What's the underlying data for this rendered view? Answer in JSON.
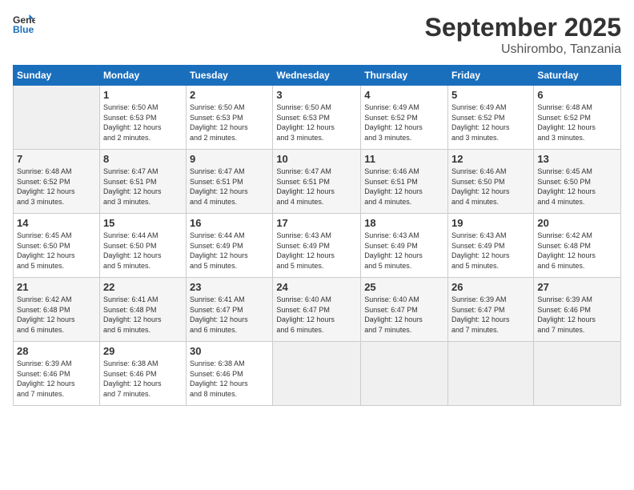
{
  "logo": {
    "line1": "General",
    "line2": "Blue"
  },
  "title": "September 2025",
  "subtitle": "Ushirombo, Tanzania",
  "days_header": [
    "Sunday",
    "Monday",
    "Tuesday",
    "Wednesday",
    "Thursday",
    "Friday",
    "Saturday"
  ],
  "weeks": [
    [
      {
        "day": "",
        "info": ""
      },
      {
        "day": "1",
        "info": "Sunrise: 6:50 AM\nSunset: 6:53 PM\nDaylight: 12 hours\nand 2 minutes."
      },
      {
        "day": "2",
        "info": "Sunrise: 6:50 AM\nSunset: 6:53 PM\nDaylight: 12 hours\nand 2 minutes."
      },
      {
        "day": "3",
        "info": "Sunrise: 6:50 AM\nSunset: 6:53 PM\nDaylight: 12 hours\nand 3 minutes."
      },
      {
        "day": "4",
        "info": "Sunrise: 6:49 AM\nSunset: 6:52 PM\nDaylight: 12 hours\nand 3 minutes."
      },
      {
        "day": "5",
        "info": "Sunrise: 6:49 AM\nSunset: 6:52 PM\nDaylight: 12 hours\nand 3 minutes."
      },
      {
        "day": "6",
        "info": "Sunrise: 6:48 AM\nSunset: 6:52 PM\nDaylight: 12 hours\nand 3 minutes."
      }
    ],
    [
      {
        "day": "7",
        "info": "Sunrise: 6:48 AM\nSunset: 6:52 PM\nDaylight: 12 hours\nand 3 minutes."
      },
      {
        "day": "8",
        "info": "Sunrise: 6:47 AM\nSunset: 6:51 PM\nDaylight: 12 hours\nand 3 minutes."
      },
      {
        "day": "9",
        "info": "Sunrise: 6:47 AM\nSunset: 6:51 PM\nDaylight: 12 hours\nand 4 minutes."
      },
      {
        "day": "10",
        "info": "Sunrise: 6:47 AM\nSunset: 6:51 PM\nDaylight: 12 hours\nand 4 minutes."
      },
      {
        "day": "11",
        "info": "Sunrise: 6:46 AM\nSunset: 6:51 PM\nDaylight: 12 hours\nand 4 minutes."
      },
      {
        "day": "12",
        "info": "Sunrise: 6:46 AM\nSunset: 6:50 PM\nDaylight: 12 hours\nand 4 minutes."
      },
      {
        "day": "13",
        "info": "Sunrise: 6:45 AM\nSunset: 6:50 PM\nDaylight: 12 hours\nand 4 minutes."
      }
    ],
    [
      {
        "day": "14",
        "info": "Sunrise: 6:45 AM\nSunset: 6:50 PM\nDaylight: 12 hours\nand 5 minutes."
      },
      {
        "day": "15",
        "info": "Sunrise: 6:44 AM\nSunset: 6:50 PM\nDaylight: 12 hours\nand 5 minutes."
      },
      {
        "day": "16",
        "info": "Sunrise: 6:44 AM\nSunset: 6:49 PM\nDaylight: 12 hours\nand 5 minutes."
      },
      {
        "day": "17",
        "info": "Sunrise: 6:43 AM\nSunset: 6:49 PM\nDaylight: 12 hours\nand 5 minutes."
      },
      {
        "day": "18",
        "info": "Sunrise: 6:43 AM\nSunset: 6:49 PM\nDaylight: 12 hours\nand 5 minutes."
      },
      {
        "day": "19",
        "info": "Sunrise: 6:43 AM\nSunset: 6:49 PM\nDaylight: 12 hours\nand 5 minutes."
      },
      {
        "day": "20",
        "info": "Sunrise: 6:42 AM\nSunset: 6:48 PM\nDaylight: 12 hours\nand 6 minutes."
      }
    ],
    [
      {
        "day": "21",
        "info": "Sunrise: 6:42 AM\nSunset: 6:48 PM\nDaylight: 12 hours\nand 6 minutes."
      },
      {
        "day": "22",
        "info": "Sunrise: 6:41 AM\nSunset: 6:48 PM\nDaylight: 12 hours\nand 6 minutes."
      },
      {
        "day": "23",
        "info": "Sunrise: 6:41 AM\nSunset: 6:47 PM\nDaylight: 12 hours\nand 6 minutes."
      },
      {
        "day": "24",
        "info": "Sunrise: 6:40 AM\nSunset: 6:47 PM\nDaylight: 12 hours\nand 6 minutes."
      },
      {
        "day": "25",
        "info": "Sunrise: 6:40 AM\nSunset: 6:47 PM\nDaylight: 12 hours\nand 7 minutes."
      },
      {
        "day": "26",
        "info": "Sunrise: 6:39 AM\nSunset: 6:47 PM\nDaylight: 12 hours\nand 7 minutes."
      },
      {
        "day": "27",
        "info": "Sunrise: 6:39 AM\nSunset: 6:46 PM\nDaylight: 12 hours\nand 7 minutes."
      }
    ],
    [
      {
        "day": "28",
        "info": "Sunrise: 6:39 AM\nSunset: 6:46 PM\nDaylight: 12 hours\nand 7 minutes."
      },
      {
        "day": "29",
        "info": "Sunrise: 6:38 AM\nSunset: 6:46 PM\nDaylight: 12 hours\nand 7 minutes."
      },
      {
        "day": "30",
        "info": "Sunrise: 6:38 AM\nSunset: 6:46 PM\nDaylight: 12 hours\nand 8 minutes."
      },
      {
        "day": "",
        "info": ""
      },
      {
        "day": "",
        "info": ""
      },
      {
        "day": "",
        "info": ""
      },
      {
        "day": "",
        "info": ""
      }
    ]
  ]
}
